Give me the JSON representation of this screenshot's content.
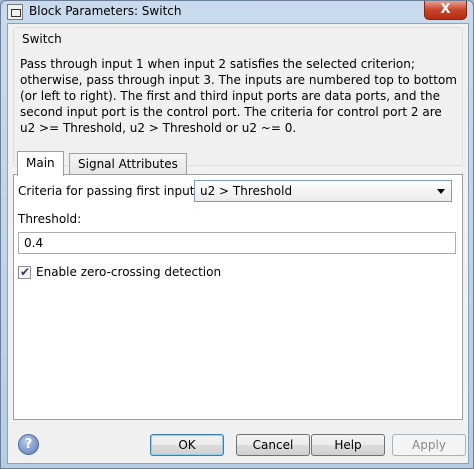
{
  "window": {
    "title": "Block Parameters: Switch",
    "close_label": "X"
  },
  "description": {
    "group_title": "Switch",
    "text": "Pass through input 1 when input 2 satisfies the selected criterion; otherwise, pass through input 3. The inputs are numbered top to bottom (or left to right). The first and third input ports are data ports, and the second input port is the control port. The criteria for control port 2 are u2 >= Threshold, u2 > Threshold or u2 ~= 0."
  },
  "tabs": [
    {
      "label": "Main",
      "active": true
    },
    {
      "label": "Signal Attributes",
      "active": false
    }
  ],
  "main": {
    "criteria_label": "Criteria for passing first input:",
    "criteria_value": "u2 > Threshold",
    "threshold_label": "Threshold:",
    "threshold_value": "0.4",
    "zero_crossing_label": "Enable zero-crossing detection",
    "zero_crossing_checked": true
  },
  "buttons": {
    "help_icon": "?",
    "ok": "OK",
    "cancel": "Cancel",
    "help": "Help",
    "apply": "Apply"
  },
  "icons": {
    "help": "help-icon",
    "check": "check-icon",
    "dropdown": "chevron-down-icon"
  }
}
